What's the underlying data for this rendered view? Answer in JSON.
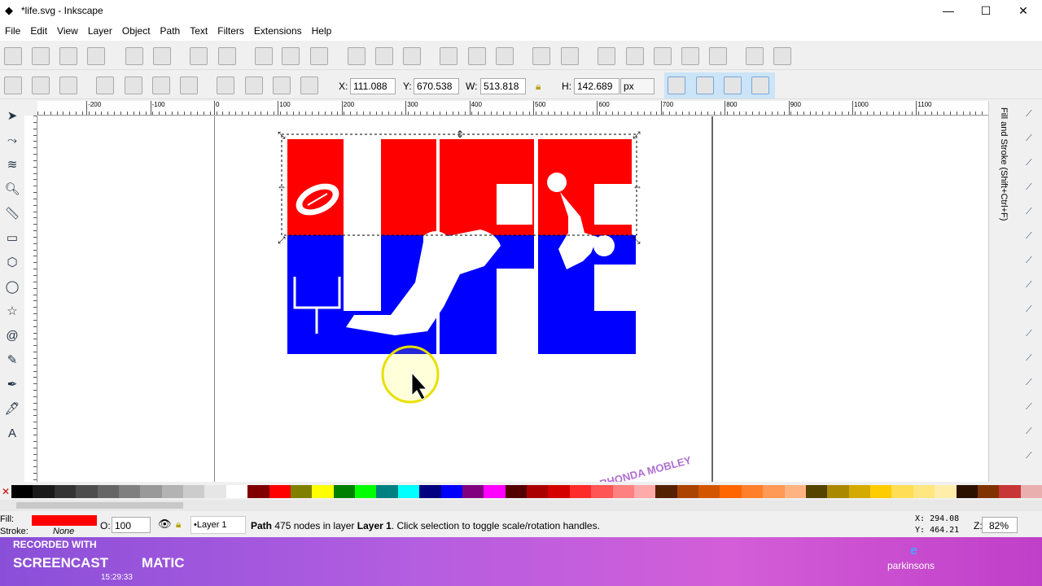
{
  "window": {
    "title": "*life.svg - Inkscape",
    "minimize": "—",
    "maximize": "☐",
    "close": "✕"
  },
  "menu": [
    "File",
    "Edit",
    "View",
    "Layer",
    "Object",
    "Path",
    "Text",
    "Filters",
    "Extensions",
    "Help"
  ],
  "toolbar": {
    "x_label": "X:",
    "x": "111.088",
    "y_label": "Y:",
    "y": "670.538",
    "w_label": "W:",
    "w": "513.818",
    "h_label": "H:",
    "h": "142.689",
    "unit": "px"
  },
  "ruler_labels": [
    "-200",
    "-100",
    "0",
    "100",
    "200",
    "300",
    "400",
    "500",
    "600",
    "700",
    "800",
    "900",
    "1000",
    "1100"
  ],
  "dock": {
    "panel_title": "Fill and Stroke (Shift+Ctrl+F)"
  },
  "canvas": {
    "watermark": "RHONDA MOBLEY",
    "colors": {
      "red": "#ff0000",
      "blue": "#0000ff"
    }
  },
  "palette": [
    "#000000",
    "#1a1a1a",
    "#333333",
    "#4d4d4d",
    "#666666",
    "#808080",
    "#999999",
    "#b3b3b3",
    "#cccccc",
    "#e6e6e6",
    "#ffffff",
    "#800000",
    "#ff0000",
    "#808000",
    "#ffff00",
    "#008000",
    "#00ff00",
    "#008080",
    "#00ffff",
    "#000080",
    "#0000ff",
    "#800080",
    "#ff00ff",
    "#550000",
    "#aa0000",
    "#d40000",
    "#ff2a2a",
    "#ff5555",
    "#ff8080",
    "#ffaaaa",
    "#552200",
    "#aa4400",
    "#d45500",
    "#ff6600",
    "#ff7f2a",
    "#ff9955",
    "#ffb380",
    "#554400",
    "#aa8800",
    "#d4aa00",
    "#ffcc00",
    "#ffdd55",
    "#ffe680",
    "#ffeeaa",
    "#2b1100",
    "#803300",
    "#c83737",
    "#e9afaf"
  ],
  "status": {
    "fill_label": "Fill:",
    "fill_color": "#ff0000",
    "stroke_label": "Stroke:",
    "stroke_value": "None",
    "opacity_label": "O:",
    "opacity": "100",
    "layer": "•Layer 1",
    "msg_type": "Path",
    "msg_mid": " 475 nodes in layer ",
    "msg_layer": "Layer 1",
    "msg_end": ". Click selection to toggle scale/rotation handles.",
    "cursor_x_label": "X:",
    "cursor_x": "294.08",
    "cursor_y_label": "Y:",
    "cursor_y": "464.21",
    "zoom_label": "Z:",
    "zoom": "82%"
  },
  "desktop": {
    "recorded": "RECORDED WITH",
    "screencast": "SCREENCAST",
    "matic": "MATIC",
    "clock": "15:29:33",
    "icon_label": "parkinsons"
  }
}
